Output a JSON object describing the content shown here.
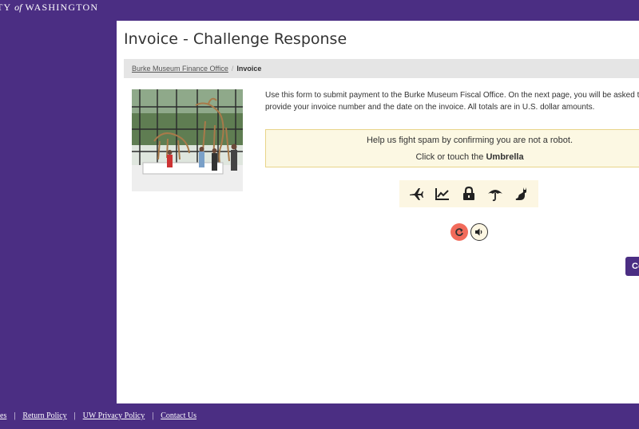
{
  "header": {
    "brand_pre": "TY",
    "brand_of": "of",
    "brand_post": "WASHINGTON"
  },
  "page": {
    "title": "Invoice - Challenge Response"
  },
  "breadcrumb": {
    "link": "Burke Museum Finance Office",
    "separator": "/",
    "current": "Invoice"
  },
  "intro": {
    "text": "Use this form to submit payment to the Burke Museum Fiscal Office. On the next page, you will be asked to provide your invoice number and the date on the invoice. All totals are in U.S. dollar amounts."
  },
  "captcha": {
    "message": "Help us fight spam by confirming you are not a robot.",
    "instruction_prefix": "Click or touch the",
    "target": "Umbrella",
    "icons": [
      "airplane-icon",
      "chart-icon",
      "lock-icon",
      "umbrella-icon",
      "cat-icon"
    ],
    "refresh_icon": "refresh-icon",
    "audio_icon": "speaker-icon"
  },
  "actions": {
    "continue_label": "Co"
  },
  "footer": {
    "links": [
      "es",
      "Return Policy",
      "UW Privacy Policy",
      "Contact Us"
    ],
    "separator": "|"
  },
  "colors": {
    "brand_purple": "#4b2e83",
    "alert_bg": "#fcf8e3",
    "refresh_red": "#f26b5b"
  }
}
